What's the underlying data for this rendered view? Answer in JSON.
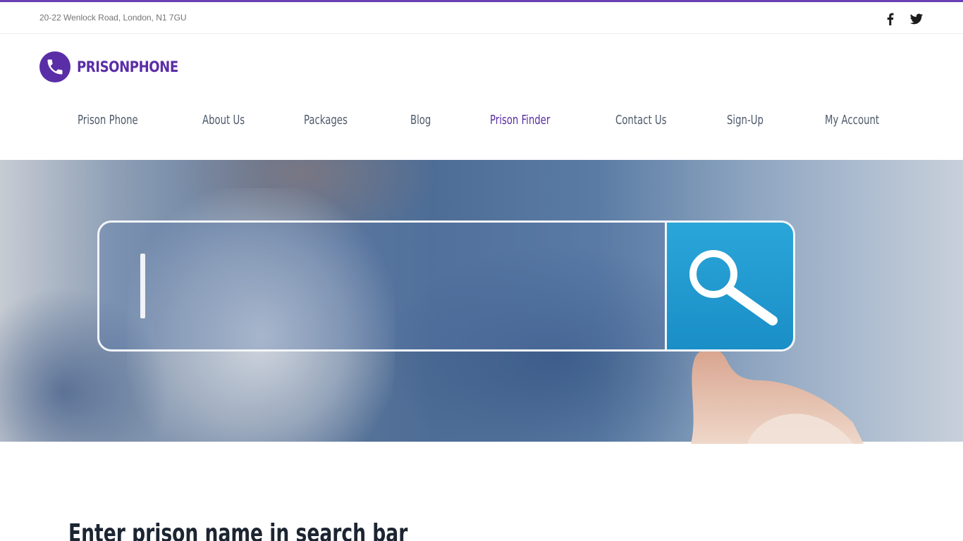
{
  "topbar": {
    "address": "20-22 Wenlock Road, London, N1 7GU",
    "social": [
      {
        "icon": "facebook-icon"
      },
      {
        "icon": "twitter-icon"
      }
    ]
  },
  "brand": {
    "name": "PRISONPHONE",
    "logo_icon": "phone-icon",
    "color": "#5a2ea6"
  },
  "nav": {
    "items": [
      {
        "label": "Prison Phone",
        "active": false
      },
      {
        "label": "About Us",
        "active": false
      },
      {
        "label": "Packages",
        "active": false
      },
      {
        "label": "Blog",
        "active": false
      },
      {
        "label": "Prison Finder",
        "active": true
      },
      {
        "label": "Contact Us",
        "active": false
      },
      {
        "label": "Sign-Up",
        "active": false
      },
      {
        "label": "My Account",
        "active": false
      }
    ],
    "active_color": "#5a2ea6",
    "text_color": "#4e5a6a"
  },
  "hero": {
    "search_icon": "magnifier-icon"
  },
  "content": {
    "heading": "Enter prison name in search bar"
  },
  "colors": {
    "accent": "#6a3fb5",
    "search_button": "#1a8ec7"
  }
}
